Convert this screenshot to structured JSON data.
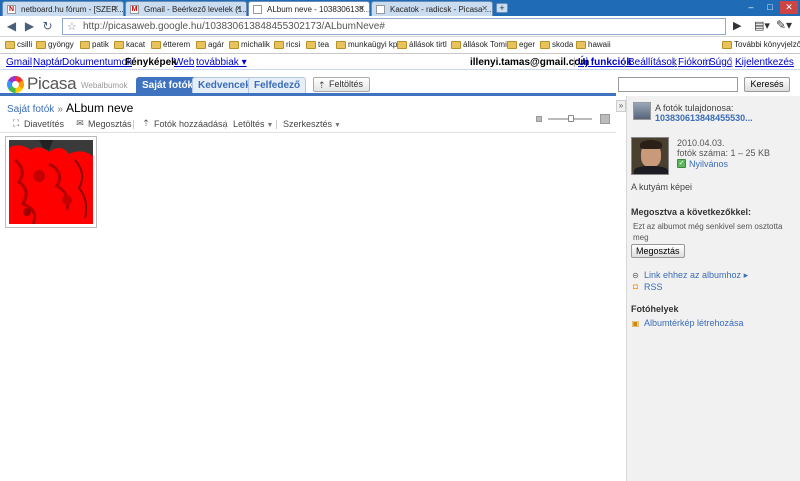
{
  "browser": {
    "tabs": [
      {
        "label": "netboard.hu fórum - [SZER...",
        "icon": "N"
      },
      {
        "label": "Gmail - Beérkező levelek (1...",
        "icon": "M"
      },
      {
        "label": "ALbum neve - 1038306138...",
        "icon": ""
      },
      {
        "label": "Kacatok - radicsk - Picasa ...",
        "icon": ""
      }
    ],
    "url": "http://picasaweb.google.hu/103830613848455302173/ALbumNeve#",
    "bookmarks": [
      "csilli",
      "gyöngy",
      "patik",
      "kacat",
      "étterem",
      "agár",
      "michalik",
      "ricsi",
      "tea",
      "munkaügyi kp",
      "állások tirtl",
      "állások Tomi",
      "eger",
      "skoda",
      "hawaii"
    ],
    "other_bookmarks": "További könyvjelzők"
  },
  "gbar": {
    "links": [
      "Gmail",
      "Naptár",
      "Dokumentumok",
      "Fényképek",
      "Web",
      "továbbiak ▾"
    ],
    "user": "illenyi.tamas@gmail.com",
    "right_links": [
      "Új funkciók",
      "Beállítások",
      "Fiókom",
      "Súgó",
      "Kijelentkezés"
    ]
  },
  "picasa": {
    "logo_name": "Picasa",
    "logo_sub": "Webalbumok",
    "tabs": [
      "Saját fotók",
      "Kedvencek",
      "Felfedező"
    ],
    "upload_label": "Feltöltés",
    "search_placeholder": "",
    "search_button": "Keresés"
  },
  "breadcrumb": {
    "parent": "Saját fotók",
    "sep": "»",
    "title": "ALbum neve"
  },
  "toolbar": {
    "slideshow": "Diavetítés",
    "share": "Megosztás",
    "add_photos": "Fotók hozzáadása",
    "download": "Letöltés",
    "edit": "Szerkesztés"
  },
  "sidebar": {
    "owner_label": "A fotók tulajdonosa:",
    "owner_id": "103830613848455530...",
    "date": "2010.04.03.",
    "photo_count": "fotók száma: 1 – 25 KB",
    "visibility": "Nyilvános",
    "album_desc": "A kutyám képei",
    "shared_heading": "Megosztva a következőkkel:",
    "shared_text": "Ezt az albumot még senkivel sem osztotta meg",
    "share_button": "Megosztás",
    "album_link": "Link ehhez az albumhoz ▸",
    "rss": "RSS",
    "places_heading": "Fotóhelyek",
    "create_map": "Albumtérkép létrehozása"
  },
  "colors": {
    "tabstrip": "#1f6bb5",
    "picasa_tab_active": "#3f72bf",
    "link": "#3a6cb8",
    "thumb_red": "#ff0000"
  }
}
